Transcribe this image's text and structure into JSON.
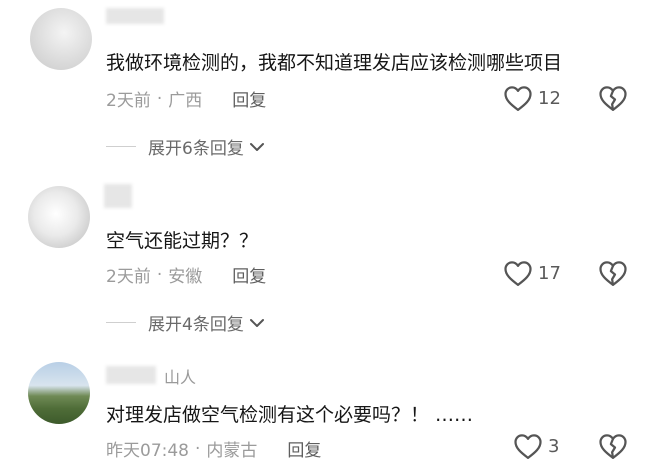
{
  "comments": [
    {
      "username": "",
      "text": "我做环境检测的，我都不知道理发店应该检测哪些项目",
      "time": "2天前",
      "location": "广西",
      "reply_label": "回复",
      "likes": "12",
      "expand_label": "展开6条回复"
    },
    {
      "username": "",
      "text": "空气还能过期？？",
      "time": "2天前",
      "location": "安徽",
      "reply_label": "回复",
      "likes": "17",
      "expand_label": "展开4条回复"
    },
    {
      "username": "山人",
      "text": "对理发店做空气检测有这个必要吗？！ ……",
      "time": "昨天07:48",
      "location": "内蒙古",
      "reply_label": "回复",
      "likes": "3"
    }
  ],
  "separator": "·",
  "icons": {
    "like": "heart-outline-icon",
    "dislike": "broken-heart-icon",
    "expand": "chevron-down-icon"
  },
  "colors": {
    "text": "#161616",
    "meta": "#9b9b9b",
    "icon": "#555555"
  }
}
